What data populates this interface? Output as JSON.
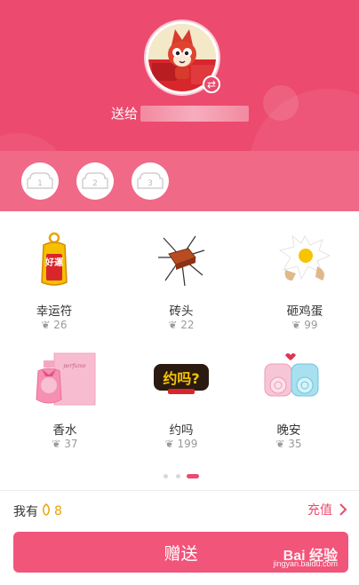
{
  "header": {
    "send_to_label": "送给",
    "tiers": [
      "1",
      "2",
      "3"
    ]
  },
  "gifts": [
    {
      "name": "幸运符",
      "price": "26",
      "icon": "lucky-charm-icon"
    },
    {
      "name": "砖头",
      "price": "22",
      "icon": "brick-icon"
    },
    {
      "name": "砸鸡蛋",
      "price": "99",
      "icon": "smashed-egg-icon"
    },
    {
      "name": "香水",
      "price": "37",
      "icon": "perfume-icon"
    },
    {
      "name": "约吗",
      "price": "199",
      "icon": "dating-sign-icon"
    },
    {
      "name": "晚安",
      "price": "35",
      "icon": "good-night-icon"
    }
  ],
  "lucky_charm_text": "好運",
  "dating_text": "约吗?",
  "perfume_text": "perfume",
  "pagination": {
    "pages": 3,
    "active": 3
  },
  "footer": {
    "balance_label": "我有",
    "balance_value": "8",
    "recharge_label": "充值",
    "send_button": "赠送"
  },
  "watermark": {
    "brand": "Bai 经验",
    "url": "jingyan.baidu.com"
  },
  "colors": {
    "accent": "#ec4a6e",
    "coin": "#e8a400"
  }
}
